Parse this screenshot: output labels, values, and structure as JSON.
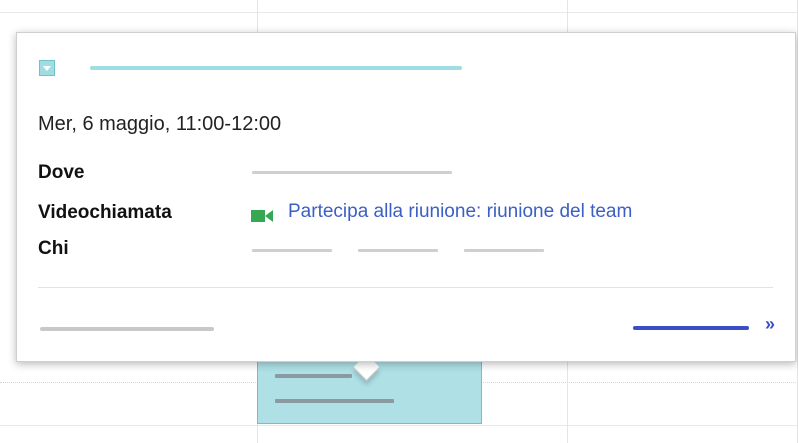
{
  "popup": {
    "datetime": "Mer, 6 maggio, 11:00-12:00",
    "fields": {
      "where_label": "Dove",
      "video_label": "Videochiamata",
      "who_label": "Chi"
    },
    "video_link_text": "Partecipa alla riunione:  riunione del team",
    "more_link_glyph": "»"
  },
  "colors": {
    "event_chip": "#9fdde3",
    "event_block": "#aee0e6",
    "link": "#3b5fc4",
    "video_icon": "#34a853"
  },
  "icons": {
    "calendar_color": "chevron-down-icon",
    "video": "video-camera-icon"
  }
}
